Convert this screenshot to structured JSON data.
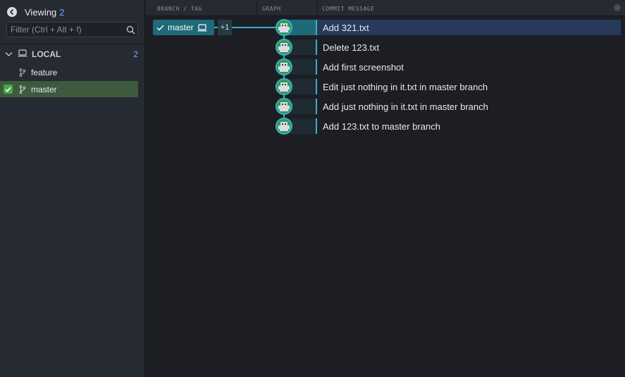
{
  "sidebar": {
    "viewing_label": "Viewing",
    "viewing_count": "2",
    "filter_placeholder": "Filter (Ctrl + Alt + f)",
    "local": {
      "label": "LOCAL",
      "count": "2"
    },
    "branches": [
      {
        "name": "feature",
        "checked": false
      },
      {
        "name": "master",
        "checked": true
      }
    ]
  },
  "header": {
    "branch_tag": "BRANCH / TAG",
    "graph": "GRAPH",
    "commit_message": "COMMIT MESSAGE"
  },
  "branch_tag": {
    "name": "master",
    "extra": "+1"
  },
  "commits": [
    {
      "message": "Add 321.txt",
      "selected": true
    },
    {
      "message": "Delete 123.txt",
      "selected": false
    },
    {
      "message": "Add first screenshot",
      "selected": false
    },
    {
      "message": "Edit just nothing in it.txt in master branch",
      "selected": false
    },
    {
      "message": "Add just nothing in it.txt in master branch",
      "selected": false
    },
    {
      "message": "Add 123.txt to master branch",
      "selected": false
    }
  ],
  "colors": {
    "accent": "#3bb0c9",
    "branch_tag_bg": "#1f6a79",
    "selection": "#283a5c",
    "active_branch": "#3d5a3e",
    "count_blue": "#6fa8ff"
  },
  "icons": [
    "back-arrow-icon",
    "search-icon",
    "chevron-down-icon",
    "laptop-icon",
    "branch-icon",
    "check-icon",
    "gear-icon",
    "avatar-icon"
  ]
}
